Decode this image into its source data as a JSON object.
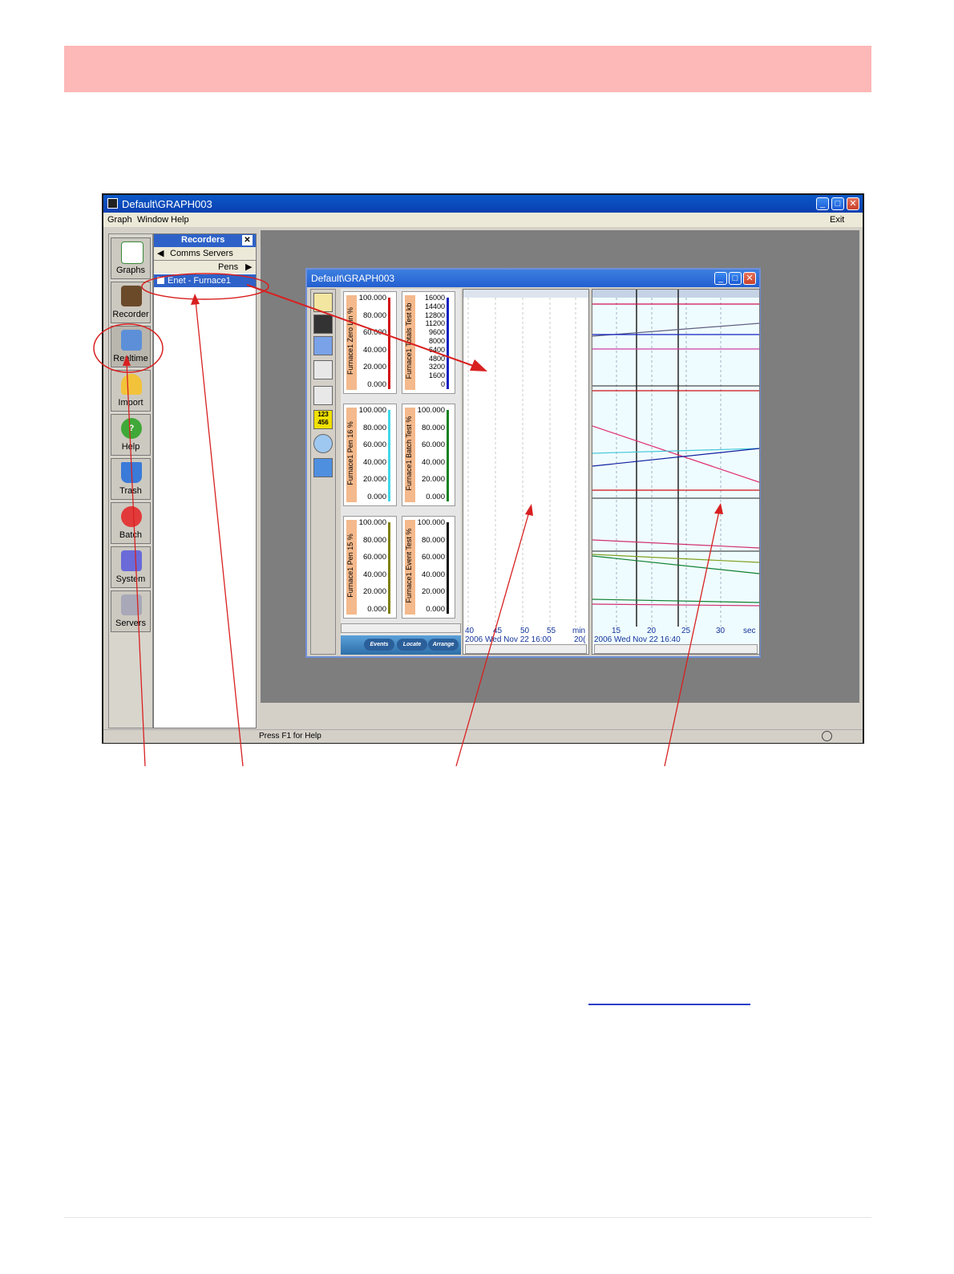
{
  "app": {
    "title": "Default\\GRAPH003",
    "menu": [
      "Graph",
      "Window",
      "Help"
    ],
    "exit_label": "Exit",
    "status_text": "Press F1 for Help"
  },
  "shortcuts": [
    {
      "label": "Graphs",
      "icon": "graph-icon"
    },
    {
      "label": "Recorder",
      "icon": "recorder-icon"
    },
    {
      "label": "Realtime",
      "icon": "realtime-icon"
    },
    {
      "label": "Import",
      "icon": "import-icon"
    },
    {
      "label": "Help",
      "icon": "help-icon"
    },
    {
      "label": "Trash",
      "icon": "trash-icon"
    },
    {
      "label": "Batch",
      "icon": "batch-icon"
    },
    {
      "label": "System",
      "icon": "system-icon"
    },
    {
      "label": "Servers",
      "icon": "servers-icon"
    }
  ],
  "recorders_panel": {
    "title": "Recorders",
    "back_label": "Comms Servers",
    "pens_label": "Pens",
    "selected_item": "Enet - Furnace1"
  },
  "graph_window": {
    "title": "Default\\GRAPH003",
    "meters": [
      {
        "label": "Furnace1 Zero Lin %",
        "ticks": [
          "100.000",
          "80.000",
          "60.000",
          "40.000",
          "20.000",
          "0.000"
        ],
        "color": "#d01010"
      },
      {
        "label": "Furnace1 Totals Test kb",
        "ticks": [
          "16000",
          "14400",
          "12800",
          "11200",
          "9600",
          "8000",
          "6400",
          "4800",
          "3200",
          "1600",
          "0"
        ],
        "color": "#1020c0"
      },
      {
        "label": "Furnace1 Pen 16 %",
        "ticks": [
          "100.000",
          "80.000",
          "60.000",
          "40.000",
          "20.000",
          "0.000"
        ],
        "color": "#40d8e8"
      },
      {
        "label": "Furnace1 Batch Test %",
        "ticks": [
          "100.000",
          "80.000",
          "60.000",
          "40.000",
          "20.000",
          "0.000"
        ],
        "color": "#108020"
      },
      {
        "label": "Furnace1 Pen 15 %",
        "ticks": [
          "100.000",
          "80.000",
          "60.000",
          "40.000",
          "20.000",
          "0.000"
        ],
        "color": "#808010"
      },
      {
        "label": "Furnace1 Event Test %",
        "ticks": [
          "100.000",
          "80.000",
          "60.000",
          "40.000",
          "20.000",
          "0.000"
        ],
        "color": "#101010"
      }
    ],
    "buttons": [
      "Events",
      "Locate",
      "Arrange"
    ],
    "left_axis": {
      "ticks": [
        "40",
        "45",
        "50",
        "55"
      ],
      "unit": "min",
      "date": "2006 Wed Nov 22  16:00",
      "date_tail": "20("
    },
    "right_axis": {
      "ticks": [
        "15",
        "20",
        "25",
        "30"
      ],
      "unit": "sec",
      "date": "2006 Wed Nov 22  16:40"
    }
  }
}
